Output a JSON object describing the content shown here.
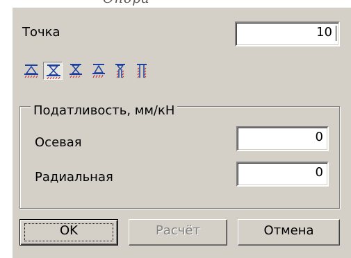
{
  "caption": {
    "text": "Опора"
  },
  "point": {
    "label": "Точка",
    "value": "10"
  },
  "support_types": [
    {
      "icon": "support-type-1-icon",
      "pressed": false
    },
    {
      "icon": "support-type-2-icon",
      "pressed": true
    },
    {
      "icon": "support-type-3-icon",
      "pressed": false
    },
    {
      "icon": "support-type-4-icon",
      "pressed": false
    },
    {
      "icon": "support-type-5-icon",
      "pressed": false
    },
    {
      "icon": "support-type-6-icon",
      "pressed": false
    }
  ],
  "compliance": {
    "title": "Податливость, мм/кН",
    "axial": {
      "label": "Осевая",
      "value": "0"
    },
    "radial": {
      "label": "Радиальная",
      "value": "0"
    }
  },
  "buttons": {
    "ok": "OK",
    "calculate": "Расчёт",
    "cancel": "Отмена"
  },
  "colors": {
    "dialog_bg": "#d4d0c8",
    "icon_blue": "#1a3f9e",
    "icon_red": "#c42020"
  }
}
